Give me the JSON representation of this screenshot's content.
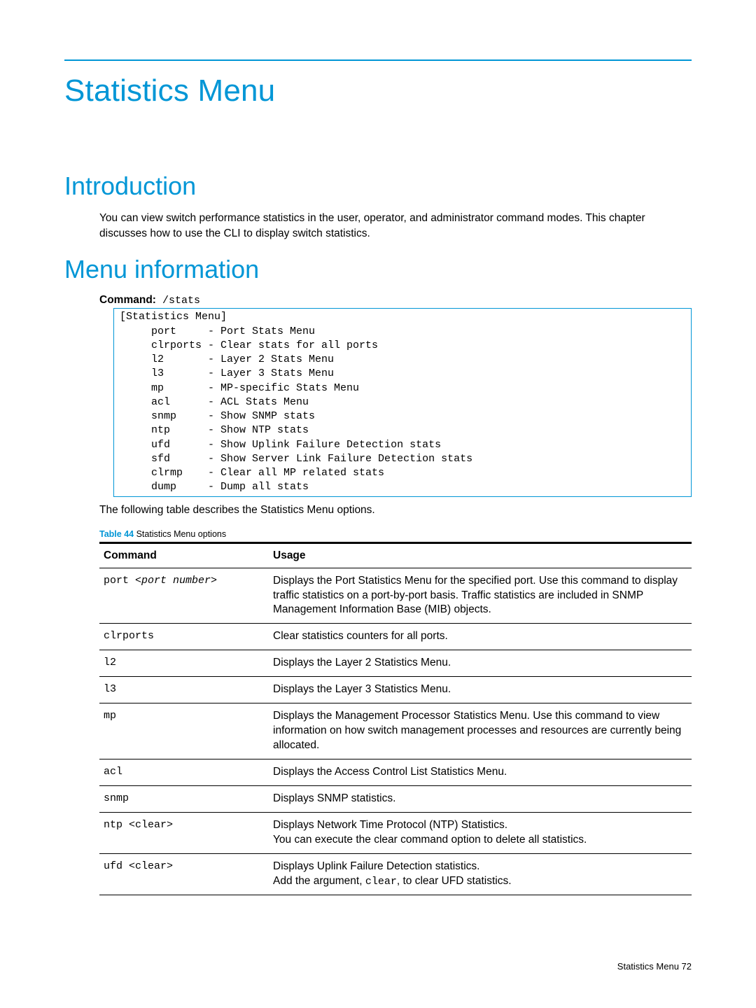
{
  "chapter_title": "Statistics Menu",
  "sections": {
    "intro": {
      "title": "Introduction",
      "body": "You can view switch performance statistics in the user, operator, and administrator command modes. This chapter discusses how to use the CLI to display switch statistics."
    },
    "menu": {
      "title": "Menu information",
      "command_label": "Command:",
      "command_value": " /stats",
      "code_block": "[Statistics Menu]\n     port     - Port Stats Menu\n     clrports - Clear stats for all ports\n     l2       - Layer 2 Stats Menu\n     l3       - Layer 3 Stats Menu\n     mp       - MP-specific Stats Menu\n     acl      - ACL Stats Menu\n     snmp     - Show SNMP stats\n     ntp      - Show NTP stats\n     ufd      - Show Uplink Failure Detection stats\n     sfd      - Show Server Link Failure Detection stats\n     clrmp    - Clear all MP related stats\n     dump     - Dump all stats",
      "after_box": "The following table describes the Statistics Menu options.",
      "table_caption_label": "Table 44",
      "table_caption_text": "  Statistics Menu options",
      "table": {
        "header": {
          "col1": "Command",
          "col2": "Usage"
        },
        "rows": [
          {
            "cmd_prefix": "port ",
            "cmd_arg": "<port number>",
            "usage": "Displays the Port Statistics Menu for the specified port. Use this command to display traffic statistics on a port-by-port basis. Traffic statistics are included in SNMP Management Information Base (MIB) objects."
          },
          {
            "cmd": "clrports",
            "usage": "Clear statistics counters for all ports."
          },
          {
            "cmd": "l2",
            "usage": "Displays the Layer 2 Statistics Menu."
          },
          {
            "cmd": "l3",
            "usage": "Displays the Layer 3 Statistics Menu."
          },
          {
            "cmd": "mp",
            "usage": "Displays the Management Processor Statistics Menu. Use this command to view information on how switch management processes and resources are currently being allocated."
          },
          {
            "cmd": "acl",
            "usage": "Displays the Access Control List Statistics Menu."
          },
          {
            "cmd": "snmp",
            "usage": "Displays SNMP statistics."
          },
          {
            "cmd": "ntp <clear>",
            "usage_line1": "Displays Network Time Protocol (NTP) Statistics.",
            "usage_line2": "You can execute the clear command option to delete all statistics."
          },
          {
            "cmd": "ufd <clear>",
            "usage_line1": "Displays Uplink Failure Detection statistics.",
            "usage_line2a": "Add the argument, ",
            "usage_line2b_mono": "clear",
            "usage_line2c": ", to clear UFD statistics."
          }
        ]
      }
    }
  },
  "footer": {
    "text": "Statistics Menu   72"
  }
}
